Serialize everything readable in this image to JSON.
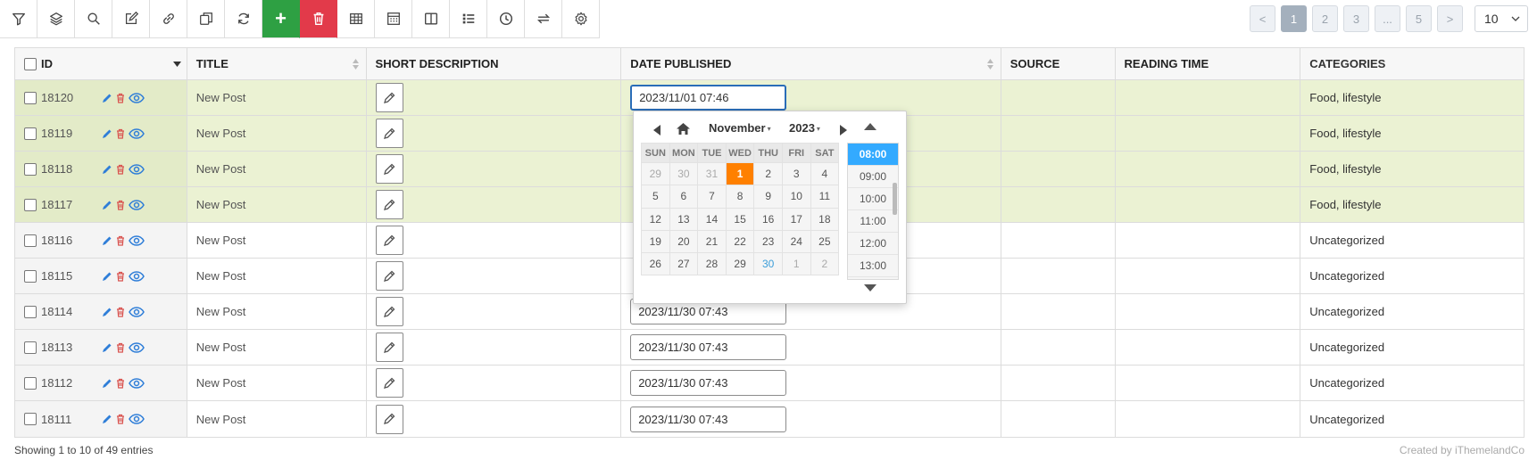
{
  "toolbar": {
    "buttons": [
      "filter-icon",
      "layers-icon",
      "search-icon",
      "edit-icon",
      "link-icon",
      "duplicate-icon",
      "refresh-icon",
      "plus-icon",
      "trash-icon",
      "table-icon",
      "calculator-icon",
      "columns-icon",
      "list-icon",
      "clock-icon",
      "swap-icon",
      "gear-icon"
    ],
    "add_label": "+"
  },
  "pagination": {
    "prev": "<",
    "pages": [
      "1",
      "2",
      "3",
      "...",
      "5"
    ],
    "next": ">",
    "active": "1",
    "per_page": "10"
  },
  "table": {
    "headers": {
      "id": "ID",
      "title": "TITLE",
      "short_description": "SHORT DESCRIPTION",
      "date_published": "DATE PUBLISHED",
      "source": "SOURCE",
      "reading_time": "READING TIME",
      "categories": "CATEGORIES"
    },
    "rows": [
      {
        "id": "18120",
        "title": "New Post",
        "date": "2023/11/01 07:46",
        "categories": "Food, lifestyle"
      },
      {
        "id": "18119",
        "title": "New Post",
        "date": "",
        "categories": "Food, lifestyle"
      },
      {
        "id": "18118",
        "title": "New Post",
        "date": "",
        "categories": "Food, lifestyle"
      },
      {
        "id": "18117",
        "title": "New Post",
        "date": "",
        "categories": "Food, lifestyle"
      },
      {
        "id": "18116",
        "title": "New Post",
        "date": "",
        "categories": "Uncategorized"
      },
      {
        "id": "18115",
        "title": "New Post",
        "date": "",
        "categories": "Uncategorized"
      },
      {
        "id": "18114",
        "title": "New Post",
        "date": "2023/11/30 07:43",
        "categories": "Uncategorized"
      },
      {
        "id": "18113",
        "title": "New Post",
        "date": "2023/11/30 07:43",
        "categories": "Uncategorized"
      },
      {
        "id": "18112",
        "title": "New Post",
        "date": "2023/11/30 07:43",
        "categories": "Uncategorized"
      },
      {
        "id": "18111",
        "title": "New Post",
        "date": "2023/11/30 07:43",
        "categories": "Uncategorized"
      }
    ]
  },
  "datepicker": {
    "month": "November",
    "year": "2023",
    "weekdays": [
      "SUN",
      "MON",
      "TUE",
      "WED",
      "THU",
      "FRI",
      "SAT"
    ],
    "weeks": [
      [
        "29",
        "30",
        "31",
        "1",
        "2",
        "3",
        "4"
      ],
      [
        "5",
        "6",
        "7",
        "8",
        "9",
        "10",
        "11"
      ],
      [
        "12",
        "13",
        "14",
        "15",
        "16",
        "17",
        "18"
      ],
      [
        "19",
        "20",
        "21",
        "22",
        "23",
        "24",
        "25"
      ],
      [
        "26",
        "27",
        "28",
        "29",
        "30",
        "1",
        "2"
      ]
    ],
    "selected_day": "1",
    "today_day": "30",
    "times": [
      "08:00",
      "09:00",
      "10:00",
      "11:00",
      "12:00",
      "13:00"
    ],
    "selected_time": "08:00"
  },
  "footer": {
    "entries": "Showing 1 to 10 of 49 entries",
    "credit": "Created by iThemelandCo"
  },
  "colors": {
    "add": "#2ea043",
    "delete": "#e23a4a",
    "highlight_row": "#ebf2d3",
    "selected_day": "#ff8000",
    "selected_time": "#33aaff",
    "edit_icon": "#2f7ed8",
    "trash_icon": "#d9534f",
    "eye_icon": "#2f7ed8"
  }
}
